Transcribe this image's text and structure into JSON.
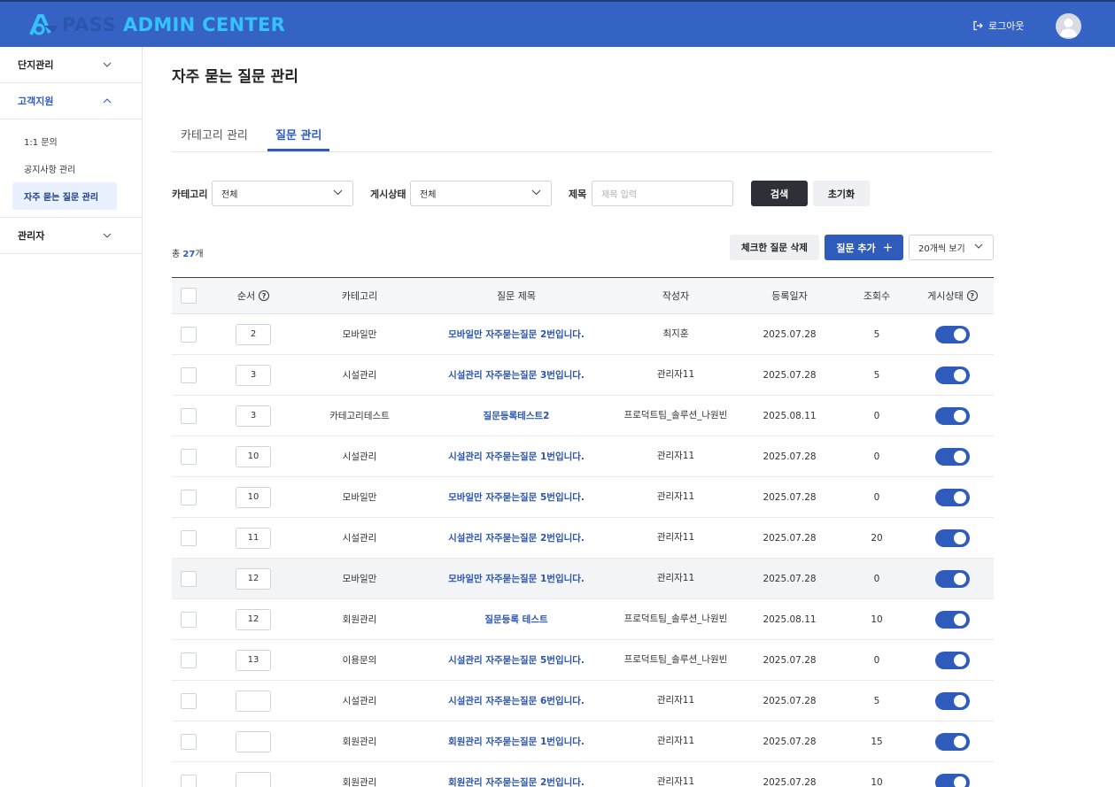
{
  "header": {
    "logo_pass": "PASS",
    "logo_admin": "ADMIN CENTER",
    "logout_label": "로그아웃"
  },
  "sidebar": {
    "groups": [
      {
        "label": "단지관리"
      },
      {
        "label": "고객지원"
      },
      {
        "label": "관리자"
      }
    ],
    "sub_items": [
      {
        "label": "1:1 문의"
      },
      {
        "label": "공지사항 관리"
      },
      {
        "label": "자주 묻는 질문 관리"
      }
    ]
  },
  "main": {
    "page_title": "자주 묻는 질문 관리",
    "tabs": [
      {
        "label": "카테고리 관리"
      },
      {
        "label": "질문 관리"
      }
    ],
    "filters": {
      "category_label": "카테고리",
      "category_value": "전체",
      "status_label": "게시상태",
      "status_value": "전체",
      "title_label": "제목",
      "title_placeholder": "제목 입력",
      "search_label": "검색",
      "reset_label": "초기화"
    },
    "total_prefix": "총 ",
    "total_count": "27",
    "total_suffix": "개",
    "delete_checked_label": "체크한 질문 삭제",
    "add_question_label": "질문 추가",
    "page_size_label": "20개씩 보기"
  },
  "table": {
    "headers": {
      "order": "순서",
      "category": "카테고리",
      "title": "질문 제목",
      "author": "작성자",
      "date": "등록일자",
      "views": "조회수",
      "status": "게시상태"
    },
    "rows": [
      {
        "order": "2",
        "category": "모바일만",
        "title": "모바일만 자주묻는질문 2번입니다.",
        "author": "최지훈",
        "date": "2025.07.28",
        "views": "5"
      },
      {
        "order": "3",
        "category": "시설관리",
        "title": "시설관리 자주묻는질문 3번입니다.",
        "author": "관리자11",
        "date": "2025.07.28",
        "views": "5"
      },
      {
        "order": "3",
        "category": "카테고리테스트",
        "title": "질문등록테스트2",
        "author": "프로덕트팀_솔루션_나원빈",
        "date": "2025.08.11",
        "views": "0"
      },
      {
        "order": "10",
        "category": "시설관리",
        "title": "시설관리 자주묻는질문 1번입니다.",
        "author": "관리자11",
        "date": "2025.07.28",
        "views": "0"
      },
      {
        "order": "10",
        "category": "모바일만",
        "title": "모바일만 자주묻는질문 5번입니다.",
        "author": "관리자11",
        "date": "2025.07.28",
        "views": "0"
      },
      {
        "order": "11",
        "category": "시설관리",
        "title": "시설관리 자주묻는질문 2번입니다.",
        "author": "관리자11",
        "date": "2025.07.28",
        "views": "20"
      },
      {
        "order": "12",
        "category": "모바일만",
        "title": "모바일만 자주묻는질문 1번입니다.",
        "author": "관리자11",
        "date": "2025.07.28",
        "views": "0"
      },
      {
        "order": "12",
        "category": "회원관리",
        "title": "질문등록 테스트",
        "author": "프로덕트팀_솔루션_나원빈",
        "date": "2025.08.11",
        "views": "10"
      },
      {
        "order": "13",
        "category": "이용문의",
        "title": "시설관리 자주묻는질문 5번입니다.",
        "author": "프로덕트팀_솔루션_나원빈",
        "date": "2025.07.28",
        "views": "0"
      },
      {
        "order": "",
        "category": "시설관리",
        "title": "시설관리 자주묻는질문 6번입니다.",
        "author": "관리자11",
        "date": "2025.07.28",
        "views": "5"
      },
      {
        "order": "",
        "category": "회원관리",
        "title": "회원관리 자주묻는질문 1번입니다.",
        "author": "관리자11",
        "date": "2025.07.28",
        "views": "15"
      },
      {
        "order": "",
        "category": "회원관리",
        "title": "회원관리 자주묻는질문 2번입니다.",
        "author": "관리자11",
        "date": "2025.07.28",
        "views": "10"
      }
    ]
  },
  "colors": {
    "header_bg": "#3563c4",
    "accent": "#2f5bbd",
    "dark_button": "#2d3037"
  }
}
